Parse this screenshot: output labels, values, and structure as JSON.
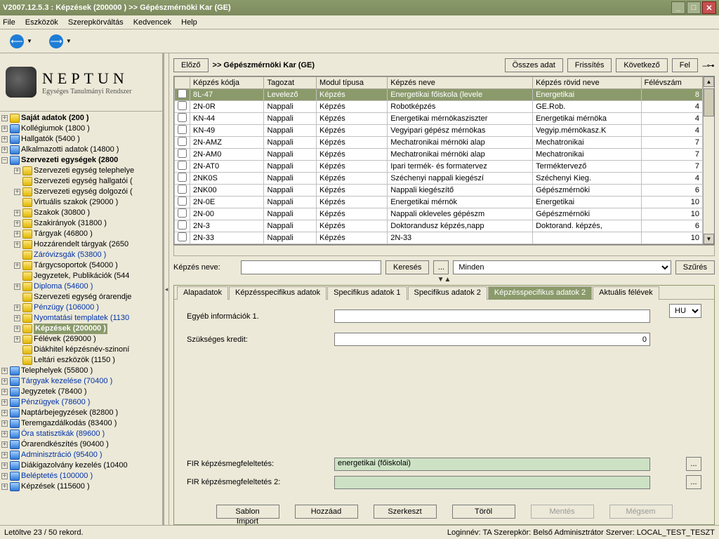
{
  "window": {
    "title": "V2007.12.5.3 : Képzések (200000  )   >> Gépészmérnöki Kar (GE)"
  },
  "menu": [
    "File",
    "Eszközök",
    "Szerepkörváltás",
    "Kedvencek",
    "Help"
  ],
  "logo": {
    "name": "NEPTUN",
    "sub": "Egységes Tanulmányi Rendszer"
  },
  "tree": [
    {
      "ind": 0,
      "tw": "+",
      "bold": true,
      "txt": "Saját adatok (200  )",
      "ic": "y"
    },
    {
      "ind": 0,
      "tw": "+",
      "txt": "Kollégiumok (1800  )",
      "ic": "b"
    },
    {
      "ind": 0,
      "tw": "+",
      "txt": "Hallgatók (5400  )",
      "ic": "b"
    },
    {
      "ind": 0,
      "tw": "+",
      "txt": "Alkalmazotti adatok (14800  )",
      "ic": "b"
    },
    {
      "ind": 0,
      "tw": "−",
      "bold": true,
      "txt": "Szervezeti egységek (2800",
      "ic": "b"
    },
    {
      "ind": 1,
      "tw": "+",
      "txt": "Szervezeti egység telephelye",
      "ic": "y"
    },
    {
      "ind": 1,
      "tw": "",
      "txt": "Szervezeti egység hallgatói (",
      "ic": "y"
    },
    {
      "ind": 1,
      "tw": "+",
      "txt": "Szervezeti egység dolgozói (",
      "ic": "y"
    },
    {
      "ind": 1,
      "tw": "",
      "txt": "Virtuális szakok (29000  )",
      "ic": "y"
    },
    {
      "ind": 1,
      "tw": "+",
      "txt": "Szakok (30800  )",
      "ic": "y"
    },
    {
      "ind": 1,
      "tw": "+",
      "txt": "Szakirányok (31800  )",
      "ic": "y"
    },
    {
      "ind": 1,
      "tw": "+",
      "txt": "Tárgyak (46800  )",
      "ic": "y"
    },
    {
      "ind": 1,
      "tw": "+",
      "txt": "Hozzárendelt tárgyak (2650",
      "ic": "y"
    },
    {
      "ind": 1,
      "tw": "",
      "blue": true,
      "txt": "Záróvizsgák (53800  )",
      "ic": "y"
    },
    {
      "ind": 1,
      "tw": "+",
      "txt": "Tárgycsoportok (54000  )",
      "ic": "y"
    },
    {
      "ind": 1,
      "tw": "",
      "txt": "Jegyzetek, Publikációk (544",
      "ic": "y"
    },
    {
      "ind": 1,
      "tw": "+",
      "blue": true,
      "txt": "Diploma (54600  )",
      "ic": "y"
    },
    {
      "ind": 1,
      "tw": "",
      "txt": "Szervezeti egység órarendje",
      "ic": "y"
    },
    {
      "ind": 1,
      "tw": "+",
      "blue": true,
      "txt": "Pénzügy (106000  )",
      "ic": "y"
    },
    {
      "ind": 1,
      "tw": "+",
      "blue": true,
      "txt": "Nyomtatási templatek (1130",
      "ic": "y"
    },
    {
      "ind": 1,
      "tw": "+",
      "sel": true,
      "txt": "Képzések  (200000  )",
      "ic": "y"
    },
    {
      "ind": 1,
      "tw": "+",
      "txt": "Félévek (269000  )",
      "ic": "y"
    },
    {
      "ind": 1,
      "tw": "",
      "txt": "Diákhitel képzésnév-szinoní",
      "ic": "y"
    },
    {
      "ind": 1,
      "tw": "",
      "txt": "Leltári eszközök (1150  )",
      "ic": "y"
    },
    {
      "ind": 0,
      "tw": "+",
      "txt": "Telephelyek (55800  )",
      "ic": "b"
    },
    {
      "ind": 0,
      "tw": "+",
      "blue": true,
      "txt": "Tárgyak kezelése (70400  )",
      "ic": "b"
    },
    {
      "ind": 0,
      "tw": "+",
      "txt": "Jegyzetek (78400  )",
      "ic": "b"
    },
    {
      "ind": 0,
      "tw": "+",
      "blue": true,
      "txt": "Pénzügyek (78600  )",
      "ic": "b"
    },
    {
      "ind": 0,
      "tw": "+",
      "txt": "Naptárbejegyzések (82800  )",
      "ic": "b"
    },
    {
      "ind": 0,
      "tw": "+",
      "txt": "Teremgazdálkodás (83400  )",
      "ic": "b"
    },
    {
      "ind": 0,
      "tw": "+",
      "blue": true,
      "txt": "Óra statisztikák (89600  )",
      "ic": "b"
    },
    {
      "ind": 0,
      "tw": "+",
      "txt": "Órarendkészítés (90400  )",
      "ic": "b"
    },
    {
      "ind": 0,
      "tw": "+",
      "blue": true,
      "txt": "Adminisztráció (95400  )",
      "ic": "b"
    },
    {
      "ind": 0,
      "tw": "+",
      "txt": "Diákigazolvány kezelés (10400",
      "ic": "b"
    },
    {
      "ind": 0,
      "tw": "+",
      "blue": true,
      "txt": "Beléptetés (100000  )",
      "ic": "b"
    },
    {
      "ind": 0,
      "tw": "+",
      "txt": "Képzések (115600  )",
      "ic": "b"
    }
  ],
  "crumb": {
    "prev": "Előző",
    "label": ">>  Gépészmérnöki Kar (GE)",
    "all": "Összes adat",
    "refresh": "Frissítés",
    "next": "Következő",
    "up": "Fel"
  },
  "grid": {
    "cols": [
      "",
      "Képzés kódja",
      "Tagozat",
      "Modul típusa",
      "Képzés neve",
      "Képzés rövid neve",
      "Félévszám"
    ],
    "rows": [
      {
        "sel": true,
        "c": [
          "8L-47",
          "Levelező",
          "Képzés",
          "Energetikai főiskola (levele",
          "Energetikai",
          "8"
        ]
      },
      {
        "c": [
          "2N-0R",
          "Nappali",
          "Képzés",
          "Robotképzés",
          "GE.Rob.",
          "4"
        ]
      },
      {
        "c": [
          "KN-44",
          "Nappali",
          "Képzés",
          "Energetikai mérnökasziszter",
          "Energetikai mérnöka",
          "4"
        ]
      },
      {
        "c": [
          "KN-49",
          "Nappali",
          "Képzés",
          "Vegyipari gépész mérnökas",
          "Vegyip.mérnökasz.K",
          "4"
        ]
      },
      {
        "c": [
          "2N-AMZ",
          "Nappali",
          "Képzés",
          "Mechatronikai mérnöki alap",
          "Mechatronikai",
          "7"
        ]
      },
      {
        "c": [
          "2N-AM0",
          "Nappali",
          "Képzés",
          "Mechatronikai mérnöki alap",
          "Mechatronikai",
          "7"
        ]
      },
      {
        "c": [
          "2N-AT0",
          "Nappali",
          "Képzés",
          "Ipari termék- és formatervez",
          "Terméktervező",
          "7"
        ]
      },
      {
        "c": [
          "2NK0S",
          "Nappali",
          "Képzés",
          "Széchenyi nappali kiegészí",
          "Széchenyi Kieg.",
          "4"
        ]
      },
      {
        "c": [
          "2NK00",
          "Nappali",
          "Képzés",
          "Nappali kiegészítő",
          "Gépészmérnöki",
          "6"
        ]
      },
      {
        "c": [
          "2N-0E",
          "Nappali",
          "Képzés",
          "Energetikai mérnök",
          "Energetikai",
          "10"
        ]
      },
      {
        "c": [
          "2N-00",
          "Nappali",
          "Képzés",
          "Nappali okleveles gépészm",
          "Gépészmérnöki",
          "10"
        ]
      },
      {
        "c": [
          "2N-3",
          "Nappali",
          "Képzés",
          "Doktorandusz képzés,napp",
          "Doktorand. képzés,",
          "6"
        ]
      },
      {
        "c": [
          "2N-33",
          "Nappali",
          "Képzés",
          "2N-33",
          "",
          "10"
        ]
      }
    ]
  },
  "search": {
    "label": "Képzés neve:",
    "btn": "Keresés",
    "ell": "...",
    "filter": "Minden",
    "filterbtn": "Szűrés"
  },
  "tabs": [
    "Alapadatok",
    "Képzésspecifikus adatok",
    "Specifikus adatok 1",
    "Specifikus adatok 2",
    "Képzésspecifikus adatok 2",
    "Aktuális félévek"
  ],
  "active_tab": 4,
  "form": {
    "lang": "HU",
    "info_lbl": "Egyéb információk 1.",
    "credit_lbl": "Szükséges kredit:",
    "credit_val": "0",
    "fir1_lbl": "FIR képzésmegfeleltetés:",
    "fir1_val": "energetikai (főiskolai)",
    "fir2_lbl": "FIR képzésmegfeleltetés 2:",
    "ell": "..."
  },
  "footer": [
    "Sablon Import",
    "Hozzáad",
    "Szerkeszt",
    "Töröl",
    "Mentés",
    "Mégsem"
  ],
  "status": {
    "left": "Letöltve 23 / 50 rekord.",
    "right": "Loginnév: TA   Szerepkör: Belső Adminisztrátor    Szerver: LOCAL_TEST_TESZT"
  }
}
